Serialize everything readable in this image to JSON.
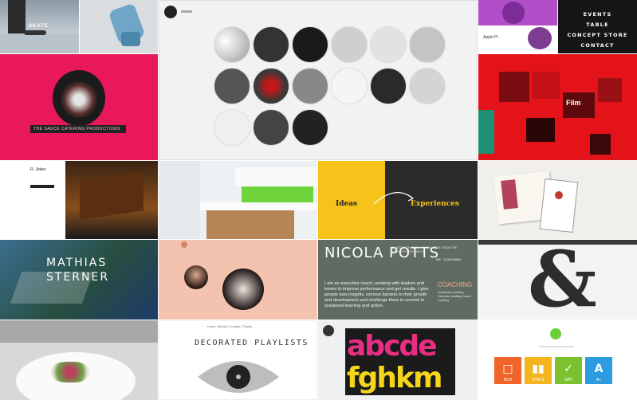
{
  "grid": {
    "t1": {
      "title": "SKATE"
    },
    "t3": {
      "brand": "Apple Pi"
    },
    "t4": {
      "menu": [
        "EVENTS",
        "TABLE",
        "CONCEPT STORE",
        "CONTACT"
      ]
    },
    "t5": {
      "banner": "THE SAUCE CATERING PRODUCTIONS"
    },
    "t6": {
      "brand": "Studio"
    },
    "t7": {
      "label": "Film"
    },
    "t8": {
      "brand": "R. Jokes"
    },
    "t10": {
      "left": "Ideas",
      "right": "Experiences"
    },
    "t12": {
      "title": "MATHIAS STERNER"
    },
    "t14": {
      "title": "NICOLA POTTS",
      "tagline": "CONFIDENCE ABOUT MY CONFIDENT BOOK THE THOUGHTS' RESEARCH",
      "nav": "ME · COACHING",
      "heading": "COACHING",
      "side": "Leadership coaching Executive coaching Career coaching",
      "body": "I am an executive coach, working with leaders and teams to improve performance and get results. I give people new insights, remove barriers to their growth and development and challenge them to commit to sustained learning and action."
    },
    "t17": {
      "title": "DECORATED PLAYLISTS",
      "nav": "Home | About | Contact | Tracks"
    },
    "t20": {
      "apps": [
        {
          "label": "BOX",
          "color": "#f0642a",
          "glyph": "□"
        },
        {
          "label": "STATS",
          "color": "#f3b41c",
          "glyph": "▮▮"
        },
        {
          "label": "WIN",
          "color": "#7cc22e",
          "glyph": "✓"
        },
        {
          "label": "A+",
          "color": "#2d9be0",
          "glyph": "A"
        }
      ]
    }
  },
  "colors": {
    "pink": "#e8185a",
    "red": "#e4131a",
    "yellow": "#f7c21a",
    "dark": "#2b2b2b",
    "slate": "#5f6c62",
    "peach": "#f4c3b0"
  }
}
